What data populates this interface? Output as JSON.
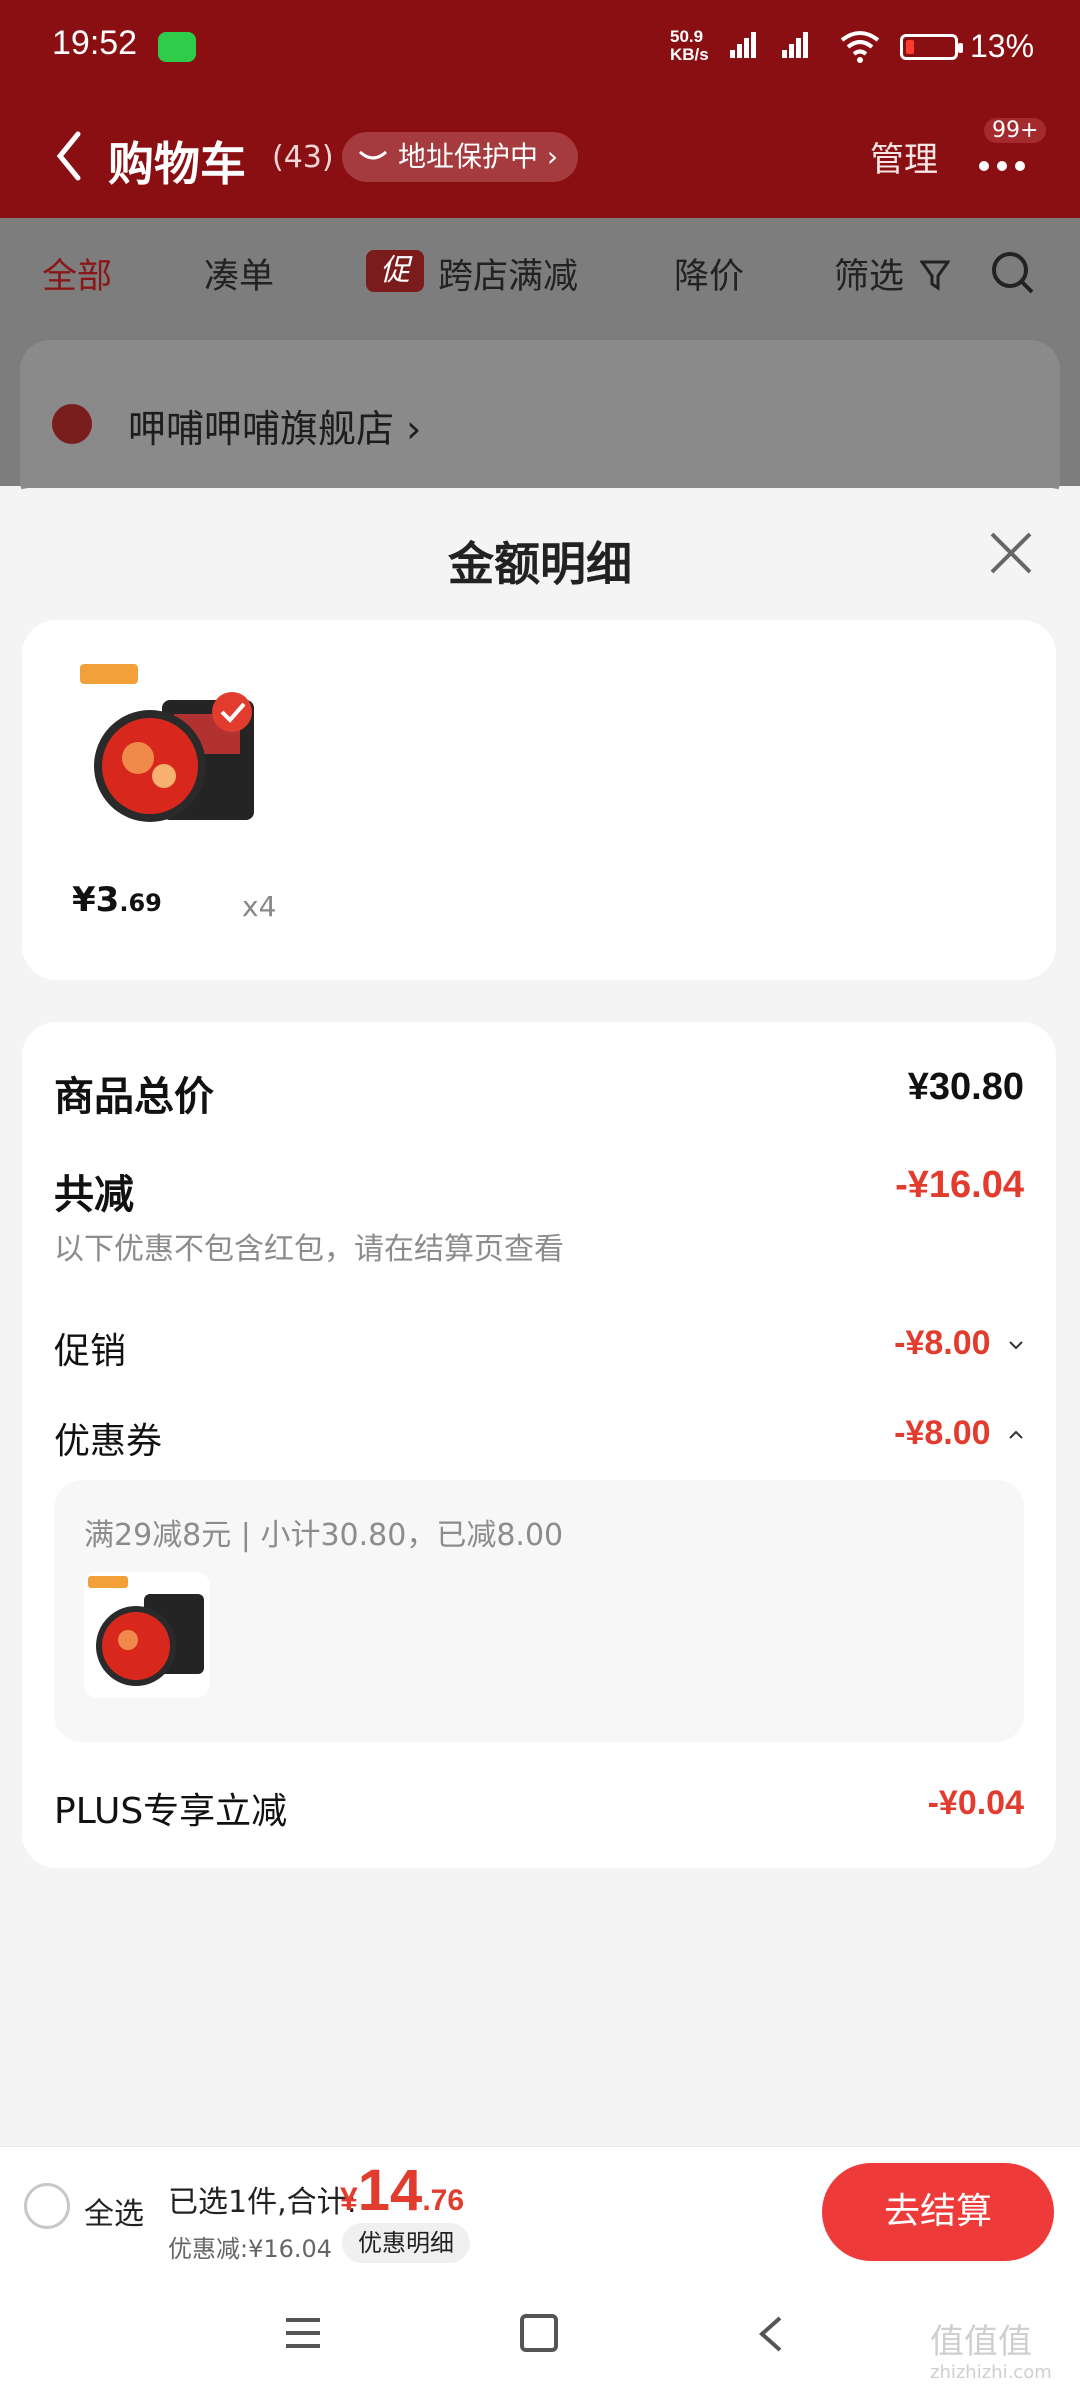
{
  "status": {
    "time": "19:52",
    "net_speed": "50.9",
    "net_unit": "KB/s",
    "battery": "13%"
  },
  "header": {
    "title": "购物车",
    "count": "(43)",
    "address_protect": "地址保护中",
    "manage": "管理",
    "badge": "99+"
  },
  "filters": {
    "all": "全部",
    "combine": "凑单",
    "promo_chip": "促",
    "cross_store": "跨店满减",
    "price_drop": "降价",
    "filter": "筛选"
  },
  "store": {
    "name": "呷哺呷哺旗舰店"
  },
  "sheet": {
    "title": "金额明细",
    "item": {
      "price_int": "¥3",
      "price_dec": ".69",
      "qty": "x4"
    },
    "summary": {
      "total_label": "商品总价",
      "total_value": "¥30.80",
      "reduce_label": "共减",
      "reduce_value": "-¥16.04",
      "hint": "以下优惠不包含红包，请在结算页查看",
      "promo_label": "促销",
      "promo_value": "-¥8.00",
      "coupon_label": "优惠券",
      "coupon_value": "-¥8.00",
      "coupon_detail": "满29减8元 | 小计30.80，已减8.00",
      "plus_label": "PLUS专享立减",
      "plus_value": "-¥0.04"
    }
  },
  "bottom": {
    "select_all": "全选",
    "selected": "已选1件,合计:",
    "total_sym": "¥",
    "total_int": "14",
    "total_dec": ".76",
    "discount": "优惠减:¥16.04",
    "detail": "优惠明细",
    "checkout": "去结算"
  },
  "watermark": {
    "main": "值值值",
    "sub": "zhizhizhi.com"
  },
  "colors": {
    "header": "#8a0f12",
    "accent": "#e23c2f",
    "checkout": "#ef3a3a"
  }
}
